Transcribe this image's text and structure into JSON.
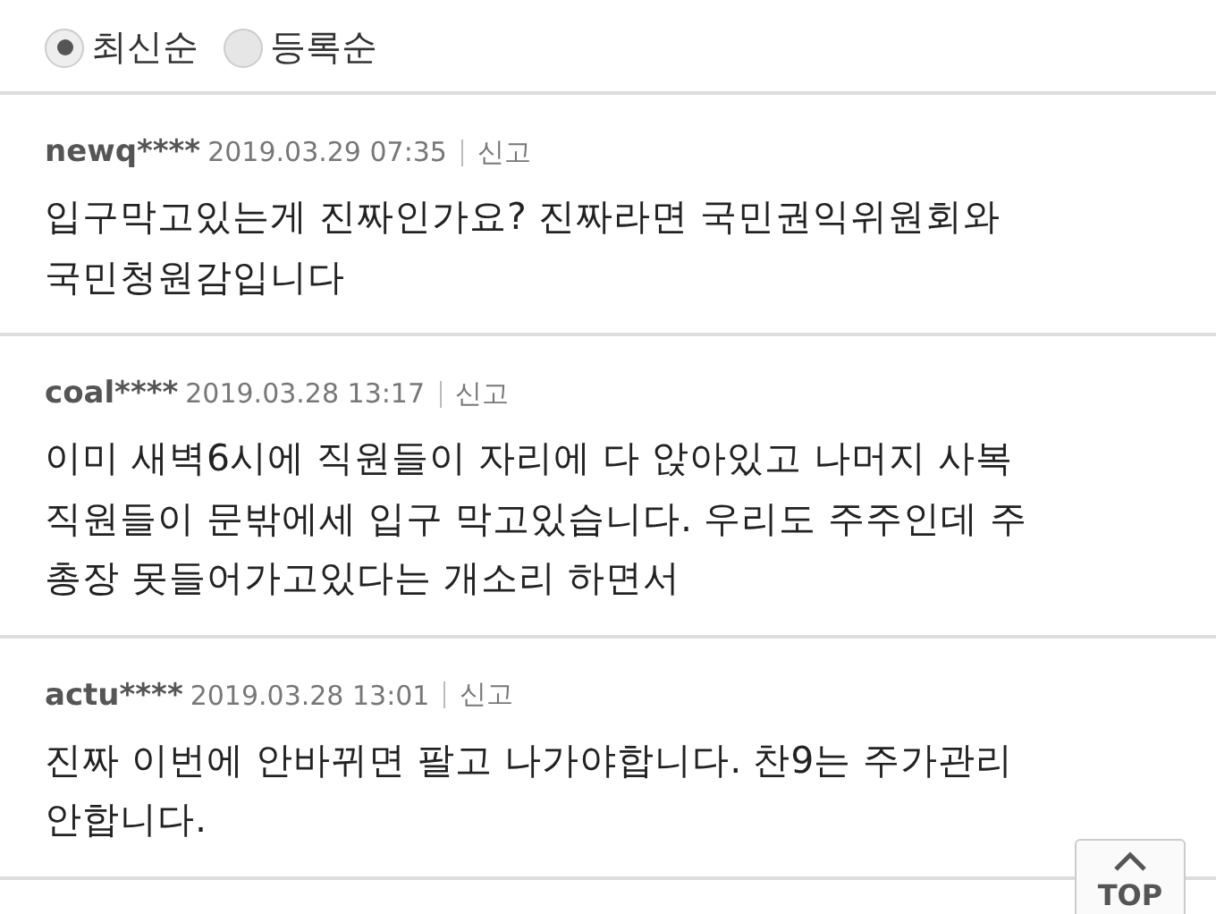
{
  "sort_options": [
    {
      "label": "최신순",
      "selected": true
    },
    {
      "label": "등록순",
      "selected": false
    }
  ],
  "comments": [
    {
      "user": "newq****",
      "date": "2019.03.29 07:35",
      "report": "신고",
      "lines": [
        "입구막고있는게 진짜인가요? 진짜라면 국민권익위원회와",
        "국민청원감입니다"
      ]
    },
    {
      "user": "coal****",
      "date": "2019.03.28 13:17",
      "report": "신고",
      "lines": [
        "이미 새벽6시에 직원들이 자리에 다 앉아있고 나머지 사복",
        "직원들이 문밖에세 입구 막고있습니다. 우리도 주주인데 주",
        "총장 못들어가고있다는 개소리 하면서"
      ]
    },
    {
      "user": "actu****",
      "date": "2019.03.28 13:01",
      "report": "신고",
      "lines": [
        "진짜 이번에 안바뀌면 팔고 나가야합니다. 찬9는 주가관리",
        "안합니다."
      ]
    }
  ],
  "top_button": {
    "label": "TOP"
  }
}
